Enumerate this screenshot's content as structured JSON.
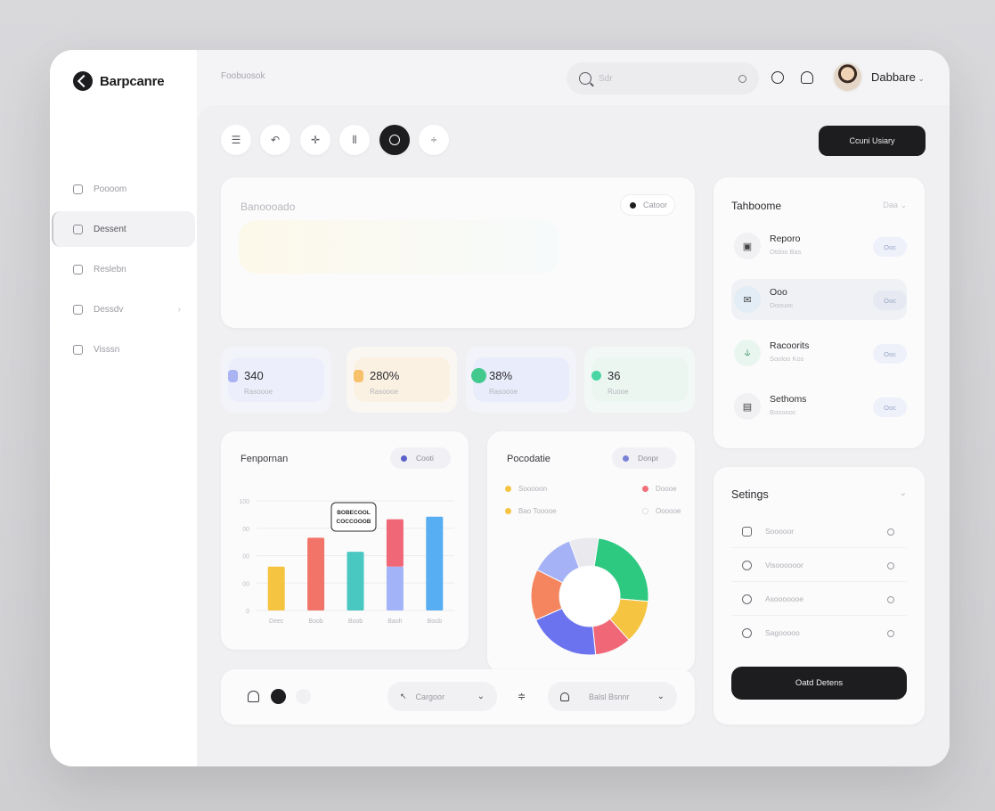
{
  "brand": {
    "name": "Barpcanre"
  },
  "topbar": {
    "crumb": "Foobuosok",
    "search_placeholder": "Sdr",
    "user_name": "Dabbare"
  },
  "sidebar": {
    "items": [
      {
        "label": "Poooom",
        "icon": "home-icon",
        "active": false
      },
      {
        "label": "Dessent",
        "icon": "dashboard-icon",
        "active": true
      },
      {
        "label": "Reslebn",
        "icon": "lock-icon",
        "active": false
      },
      {
        "label": "Dessdv",
        "icon": "card-icon",
        "active": false
      },
      {
        "label": "Visssn",
        "icon": "grid-icon",
        "active": false
      }
    ]
  },
  "toolbar": {
    "tools": [
      "menu-icon",
      "undo-icon",
      "move-icon",
      "split-icon",
      "record-icon",
      "divide-icon"
    ],
    "active_tool": "record-icon",
    "cta_label": "Ccuni Usiary"
  },
  "hero": {
    "title": "Banoooado",
    "pill_label": "Catoor"
  },
  "stats": [
    {
      "value": "340",
      "label": "Rasoooe",
      "color": "#aab4f2"
    },
    {
      "value": "280%",
      "label": "Rasoooe",
      "color": "#f7c06a"
    },
    {
      "value": "38%",
      "label": "Rasoooe",
      "color": "#41c98e"
    },
    {
      "value": "36",
      "label": "Ruooe",
      "color": "#49d6a4"
    }
  ],
  "bar_card": {
    "title": "Fenpornan",
    "chip_label": "Cooti"
  },
  "donut_card": {
    "title": "Pocodatie",
    "chip_label": "Donpr",
    "legend": [
      {
        "label": "Sooooon",
        "color": "#f5c542"
      },
      {
        "label": "Doooe",
        "color": "#f0707a"
      },
      {
        "label": "Bao Tooooe",
        "color": "#f5c542"
      },
      {
        "label": "Oooooe",
        "color": "#e4e4e8"
      }
    ]
  },
  "chart_data": [
    {
      "type": "bar",
      "categories": [
        "Deec",
        "Boob",
        "Boob",
        "Baoh",
        "Boob"
      ],
      "series": [
        {
          "values": [
            50,
            83,
            67,
            50,
            107
          ]
        },
        {
          "values": [
            0,
            0,
            0,
            54,
            0
          ]
        }
      ],
      "colors": [
        [
          "#f5c542",
          "#f27468",
          "#48c8c0",
          "#a3b3f7",
          "#58aef2"
        ],
        [
          "#ffffff",
          "#ffffff",
          "#ffffff",
          "#f06878",
          "#ffffff"
        ]
      ],
      "ylim": [
        0,
        125
      ],
      "yticks": [
        "0",
        "00",
        "00",
        "00",
        "100"
      ],
      "annotation": [
        "BOBECOOL",
        "COCCOOOB"
      ],
      "grid": true
    },
    {
      "type": "pie",
      "donut": true,
      "values": [
        24,
        12,
        10,
        20,
        14,
        12,
        8
      ],
      "colors": [
        "#2ec981",
        "#f5c542",
        "#f06878",
        "#6b73ef",
        "#f5855e",
        "#a5b2f5",
        "#e9e9ee"
      ]
    }
  ],
  "bottom_bar": {
    "category_label": "Cargoor",
    "select_label": "Balsl Bsnnr"
  },
  "side_list": {
    "title": "Tahboome",
    "more_label": "Daa",
    "items": [
      {
        "name": "Reporo",
        "sub": "Otdoo Bas",
        "badge": "Ooc",
        "icon": "report-icon",
        "active": false
      },
      {
        "name": "Ooo",
        "sub": "Ooouoc",
        "badge": "Ooc",
        "icon": "mail-icon",
        "active": true
      },
      {
        "name": "Racoorits",
        "sub": "Sooloo Kos",
        "badge": "Ooc",
        "icon": "chart-icon",
        "active": false
      },
      {
        "name": "Sethoms",
        "sub": "Boooooc",
        "badge": "Ooc",
        "icon": "folder-icon",
        "active": false
      }
    ]
  },
  "settings": {
    "title": "Setings",
    "rows": [
      {
        "label": "Sooooor",
        "icon": "device-icon"
      },
      {
        "label": "Visoooooor",
        "icon": "globe-icon"
      },
      {
        "label": "Asooooooe",
        "icon": "refresh-icon"
      },
      {
        "label": "Sagooooo",
        "icon": "clock-icon"
      }
    ],
    "button_label": "Oatd Detens"
  }
}
